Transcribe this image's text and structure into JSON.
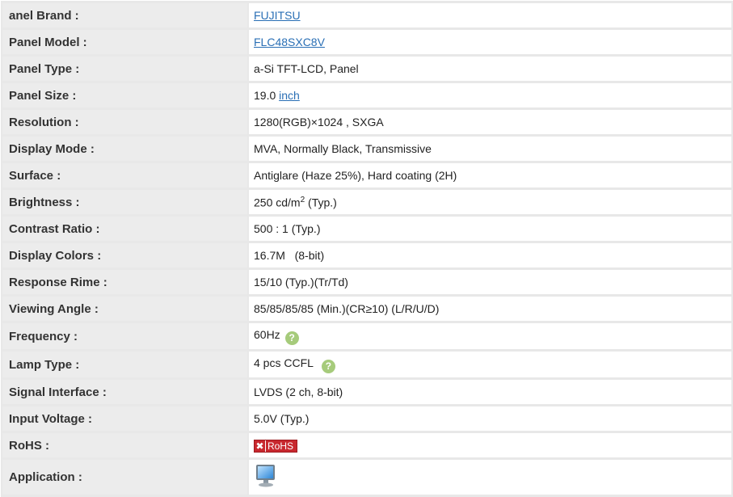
{
  "rows": [
    {
      "label": "anel Brand :",
      "value": "FUJITSU"
    },
    {
      "label": "Panel Model :",
      "value": "FLC48SXC8V"
    },
    {
      "label": "Panel Type :",
      "value": "a-Si TFT-LCD, Panel"
    },
    {
      "label": "Panel Size :",
      "value": "19.0",
      "unit_link": "inch"
    },
    {
      "label": "Resolution :",
      "value": "1280(RGB)×1024 , SXGA"
    },
    {
      "label": "Display Mode :",
      "value": "MVA, Normally Black, Transmissive"
    },
    {
      "label": "Surface :",
      "value": "Antiglare (Haze 25%), Hard coating (2H)"
    },
    {
      "label": "Brightness :",
      "value": "250 cd/m",
      "sup": "2",
      "suffix": " (Typ.)"
    },
    {
      "label": "Contrast Ratio :",
      "value": "500 : 1 (Typ.)"
    },
    {
      "label": "Display Colors :",
      "value": "16.7M   (8-bit)"
    },
    {
      "label": "Response Rime :",
      "value": "15/10 (Typ.)(Tr/Td)"
    },
    {
      "label": "Viewing Angle :",
      "value": "85/85/85/85 (Min.)(CR≥10) (L/R/U/D)"
    },
    {
      "label": "Frequency :",
      "value": "60Hz"
    },
    {
      "label": "Lamp Type :",
      "value": "4 pcs CCFL"
    },
    {
      "label": "Signal Interface :",
      "value": "LVDS (2 ch, 8-bit)"
    },
    {
      "label": "Input Voltage :",
      "value": "5.0V (Typ.)"
    },
    {
      "label": "RoHS :",
      "badge_mark": "✖",
      "badge_text": "RoHS"
    },
    {
      "label": "Application :",
      "icon": "monitor-icon"
    }
  ],
  "help_glyph": "?",
  "colors": {
    "link": "#2a6fb5",
    "help": "#a6cb7b",
    "rohs": "#c8282e"
  }
}
